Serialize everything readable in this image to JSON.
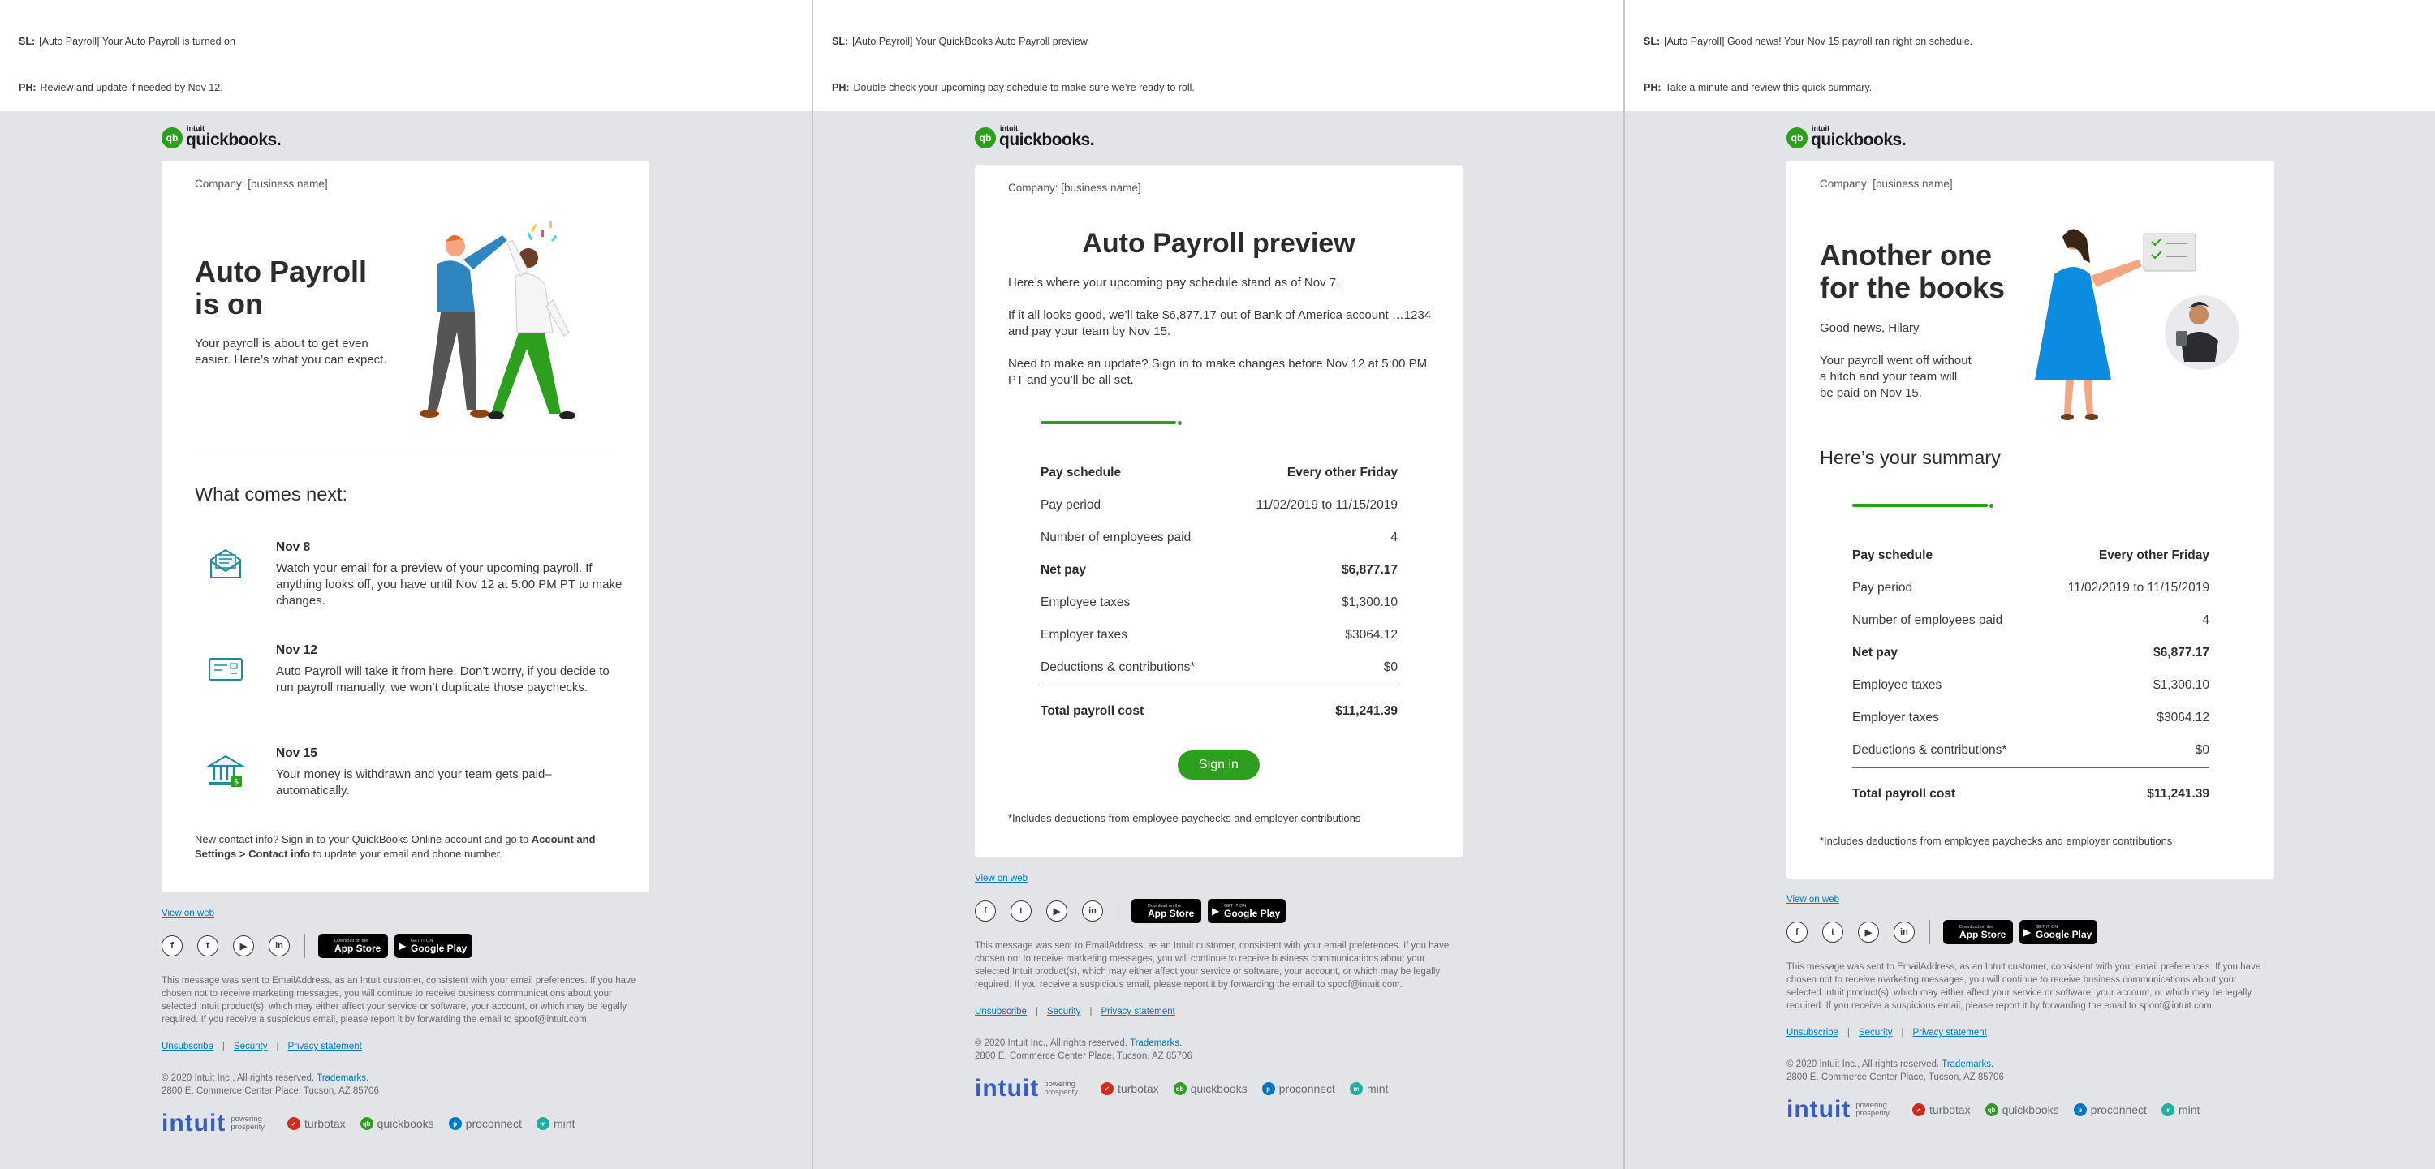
{
  "emails": [
    {
      "sl_label": "SL:",
      "sl": "[Auto Payroll] Your Auto Payroll is turned on",
      "ph_label": "PH:",
      "ph": "Review and update if needed by Nov 12.",
      "logo_text": "quickbooks.",
      "logo_intuit": "intuit",
      "company": "Company: [business name]",
      "hero_title": "Auto Payroll is on",
      "hero_body": "Your payroll is about to get even easier. Here’s what you can expect.",
      "next_title": "What comes next:",
      "steps": [
        {
          "date": "Nov 8",
          "text": "Watch your email for a preview of your upcoming payroll. If anything looks off, you have until Nov 12 at 5:00 PM PT to make changes.",
          "icon": "envelope-icon"
        },
        {
          "date": "Nov 12",
          "text": "Auto Payroll will take it from here. Don’t worry, if you decide to run payroll manually, we won’t duplicate those paychecks.",
          "icon": "check-card-icon"
        },
        {
          "date": "Nov 15",
          "text": "Your money is withdrawn and your team gets paid–automatically.",
          "icon": "bank-icon"
        }
      ],
      "contact_pre": "New contact info? Sign in to your QuickBooks Online account and go to ",
      "contact_bold": "Account and Settings > Contact info",
      "contact_post": " to update your email and phone number."
    },
    {
      "sl_label": "SL:",
      "sl": "[Auto Payroll] Your QuickBooks Auto Payroll preview",
      "ph_label": "PH:",
      "ph": "Double-check your upcoming pay schedule to make sure we’re ready to roll.",
      "logo_text": "quickbooks.",
      "logo_intuit": "intuit",
      "company": "Company: [business name]",
      "title": "Auto Payroll preview",
      "p1": "Here’s where your upcoming pay schedule stand as of Nov 7.",
      "p2": "If it all looks good, we’ll take $6,877.17 out of Bank of America account …1234 and pay your team by Nov 15.",
      "p3": "Need to make an update? Sign in to make changes before Nov 12 at 5:00 PM PT and you’ll be all set.",
      "signin": "Sign in",
      "footnote": "*Includes deductions from employee paychecks and employer contributions"
    },
    {
      "sl_label": "SL:",
      "sl": "[Auto Payroll] Good news! Your Nov 15 payroll ran right on schedule.",
      "ph_label": "PH:",
      "ph": "Take a minute and review this quick summary.",
      "logo_text": "quickbooks.",
      "logo_intuit": "intuit",
      "company": "Company: [business name]",
      "hero_title": "Another one for the books",
      "greeting": "Good news, Hilary",
      "hero_body": "Your payroll went off without a hitch and your team will be paid on Nov 15.",
      "summary_title": "Here’s your summary",
      "footnote": "*Includes deductions from employee paychecks and employer contributions"
    }
  ],
  "summary": {
    "rows": [
      {
        "label": "Pay schedule",
        "value": "Every other Friday",
        "bold": true
      },
      {
        "label": "Pay period",
        "value": "11/02/2019 to 11/15/2019",
        "bold": false
      },
      {
        "label": "Number of employees paid",
        "value": "4",
        "bold": false
      },
      {
        "label": "Net pay",
        "value": "$6,877.17",
        "bold": true
      },
      {
        "label": "Employee taxes",
        "value": "$1,300.10",
        "bold": false
      },
      {
        "label": "Employer taxes",
        "value": "$3064.12",
        "bold": false
      },
      {
        "label": "Deductions & contributions*",
        "value": "$0",
        "bold": false
      }
    ],
    "total_label": "Total payroll cost",
    "total_value": "$11,241.39"
  },
  "footer": {
    "view_on_web": "View on web",
    "social": [
      "f",
      "t",
      "▶",
      "in"
    ],
    "app_store_small": "Download on the",
    "app_store": "App Store",
    "google_play_small": "GET IT ON",
    "google_play": "Google Play",
    "legal": "This message was sent to EmailAddress, as an Intuit customer, consistent with your email preferences. If you have chosen not to receive marketing messages, you will continue to receive business communications about your selected Intuit product(s), which may either affect your service or software, your account, or which may be legally required. If you receive a suspicious email, please report it by forwarding the email to spoof@intuit.com.",
    "unsubscribe": "Unsubscribe",
    "security": "Security",
    "privacy": "Privacy statement",
    "sep": "|",
    "copyright": "© 2020 Intuit Inc., All rights reserved.",
    "trademarks": "Trademarks.",
    "address": "2800 E. Commerce Center Place, Tucson, AZ 85706",
    "intuit": "intuit",
    "tagline_1": "powering",
    "tagline_2": "prosperity",
    "brands": [
      {
        "name": "turbotax",
        "color": "#d52b1e",
        "glyph": "✓"
      },
      {
        "name": "quickbooks",
        "color": "#2ca01c",
        "glyph": "qb"
      },
      {
        "name": "proconnect",
        "color": "#0077c5",
        "glyph": "p"
      },
      {
        "name": "mint",
        "color": "#1bb1a1",
        "glyph": "m"
      }
    ]
  },
  "colors": {
    "brand_green": "#2ca01c",
    "link_blue": "#0077c5",
    "background": "#e2e4e8",
    "icon_teal": "#1e8b9a"
  }
}
